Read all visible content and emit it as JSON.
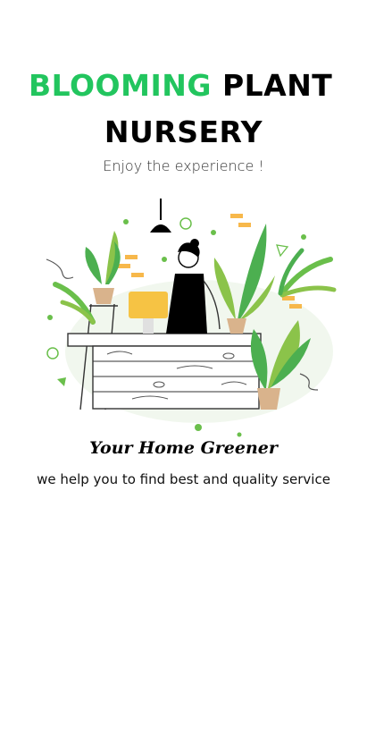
{
  "header": {
    "title_accent": "BLOOMING",
    "title_rest": "PLANT",
    "title_line2": "NURSERY",
    "subtitle": "Enjoy the experience !"
  },
  "hero": {
    "illustration": "plant-shop-keeper-illustration"
  },
  "content": {
    "tagline": "Your Home Greener",
    "description": "we help you to find best and quality service"
  },
  "colors": {
    "accent": "#22c55e",
    "leaf_dark": "#4caf50",
    "leaf_light": "#8bc34a",
    "pot": "#d9b38c",
    "monitor": "#f6c344",
    "brick": "#f7b84b"
  }
}
